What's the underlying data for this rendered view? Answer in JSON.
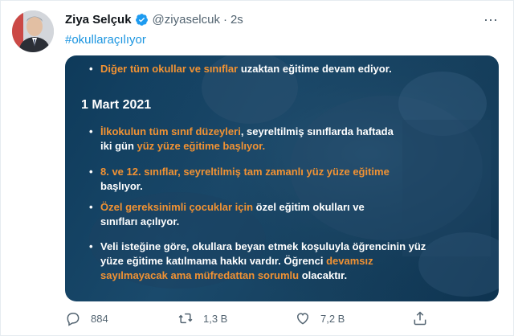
{
  "tweet": {
    "author_name": "Ziya Selçuk",
    "handle": "@ziyaselcuk",
    "separator": "·",
    "time": "2s",
    "hashtag": "#okullaraçılıyor",
    "more_label": "⋯"
  },
  "card": {
    "bullet1": {
      "orange": "Diğer tüm okullar ve sınıflar",
      "white": " uzaktan eğitime devam ediyor."
    },
    "date": "1 Mart 2021",
    "bullet2": {
      "orange1": "İlkokulun tüm sınıf düzeyleri",
      "white1": ", seyreltilmiş sınıflarda  haftada",
      "white2": "iki gün ",
      "orange2": "yüz yüze eğitime başlıyor."
    },
    "bullet3": {
      "orange": "8. ve 12. sınıflar, seyreltilmiş tam zamanlı yüz yüze eğitime",
      "white": "başlıyor."
    },
    "bullet4": {
      "orange": "Özel gereksinimli çocuklar için",
      "white1": " özel eğitim okulları ve",
      "white2": "sınıfları açılıyor."
    },
    "bullet5": {
      "line1": "Veli isteğine göre, okullara beyan etmek koşuluyla öğrencinin yüz",
      "line2_white": "yüze eğitime katılmama hakkı vardır. Öğrenci ",
      "line2_orange": "devamsız",
      "line3_orange": "sayılmayacak ama müfredattan sorumlu",
      "line3_white": " olacaktır."
    }
  },
  "actions": {
    "reply_count": "884",
    "retweet_count": "1,3 B",
    "like_count": "7,2 B"
  },
  "icons": [
    "reply-icon",
    "retweet-icon",
    "like-icon",
    "share-icon",
    "verified-icon"
  ],
  "colors": {
    "accent": "#1b95e0",
    "orange": "#f19233",
    "card_bg": "#16405e"
  }
}
